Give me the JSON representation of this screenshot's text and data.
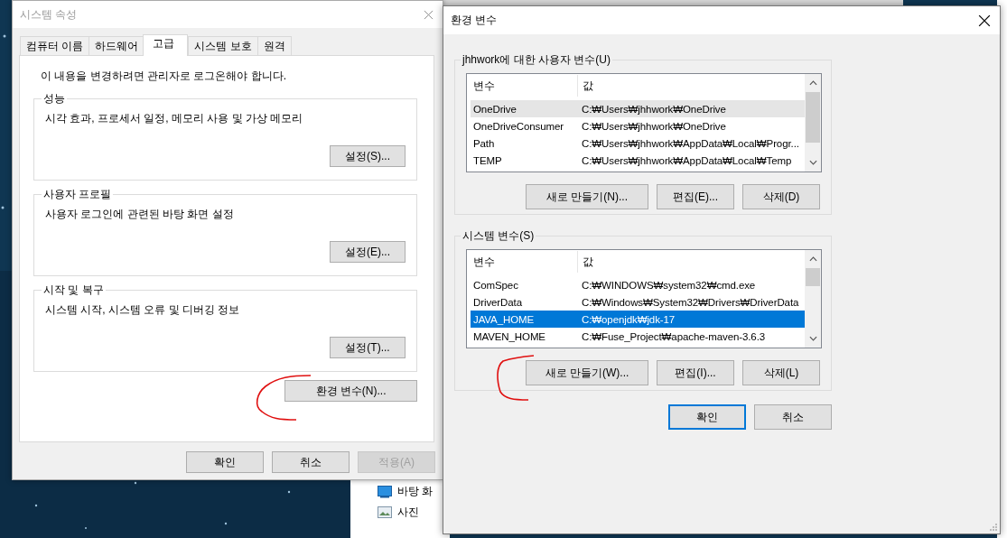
{
  "explorer": {
    "items": [
      {
        "kind": "desktop",
        "label": "바탕 화"
      },
      {
        "kind": "photos",
        "label": "사진"
      }
    ]
  },
  "system_properties": {
    "title": "시스템 속성",
    "active": false,
    "tabs": [
      {
        "label": "컴퓨터 이름",
        "selected": false
      },
      {
        "label": "하드웨어",
        "selected": false
      },
      {
        "label": "고급",
        "selected": true
      },
      {
        "label": "시스템 보호",
        "selected": false
      },
      {
        "label": "원격",
        "selected": false
      }
    ],
    "notice": "이 내용을 변경하려면 관리자로 로그온해야 합니다.",
    "groups": [
      {
        "title": "성능",
        "description": "시각 효과, 프로세서 일정, 메모리 사용 및 가상 메모리",
        "button": "설정(S)..."
      },
      {
        "title": "사용자 프로필",
        "description": "사용자 로그인에 관련된 바탕 화면 설정",
        "button": "설정(E)..."
      },
      {
        "title": "시작 및 복구",
        "description": "시스템 시작, 시스템 오류 및 디버깅 정보",
        "button": "설정(T)..."
      }
    ],
    "env_button": "환경 변수(N)...",
    "buttons": [
      {
        "label": "확인",
        "disabled": false
      },
      {
        "label": "취소",
        "disabled": false
      },
      {
        "label": "적용(A)",
        "disabled": true
      }
    ]
  },
  "environment_variables": {
    "title": "환경 변수",
    "sections": [
      {
        "title": "jhhwork에 대한 사용자 변수(U)",
        "focused": false,
        "columns": [
          "변수",
          "값"
        ],
        "rows": [
          {
            "name": "OneDrive",
            "value": "C:₩Users₩jhhwork₩OneDrive",
            "selected": true
          },
          {
            "name": "OneDriveConsumer",
            "value": "C:₩Users₩jhhwork₩OneDrive",
            "selected": false
          },
          {
            "name": "Path",
            "value": "C:₩Users₩jhhwork₩AppData₩Local₩Progr...",
            "selected": false
          },
          {
            "name": "TEMP",
            "value": "C:₩Users₩jhhwork₩AppData₩Local₩Temp",
            "selected": false
          }
        ],
        "buttons": [
          "새로 만들기(N)...",
          "편집(E)...",
          "삭제(D)"
        ]
      },
      {
        "title": "시스템 변수(S)",
        "focused": true,
        "columns": [
          "변수",
          "값"
        ],
        "rows": [
          {
            "name": "ComSpec",
            "value": "C:₩WINDOWS₩system32₩cmd.exe",
            "selected": false
          },
          {
            "name": "DriverData",
            "value": "C:₩Windows₩System32₩Drivers₩DriverData",
            "selected": false
          },
          {
            "name": "JAVA_HOME",
            "value": "C:₩openjdk₩jdk-17",
            "selected": true
          },
          {
            "name": "MAVEN_HOME",
            "value": "C:₩Fuse_Project₩apache-maven-3.6.3",
            "selected": false
          }
        ],
        "buttons": [
          "새로 만들기(W)...",
          "편집(I)...",
          "삭제(L)"
        ]
      }
    ],
    "buttons": [
      {
        "label": "확인",
        "default": true
      },
      {
        "label": "취소",
        "default": false
      }
    ]
  }
}
